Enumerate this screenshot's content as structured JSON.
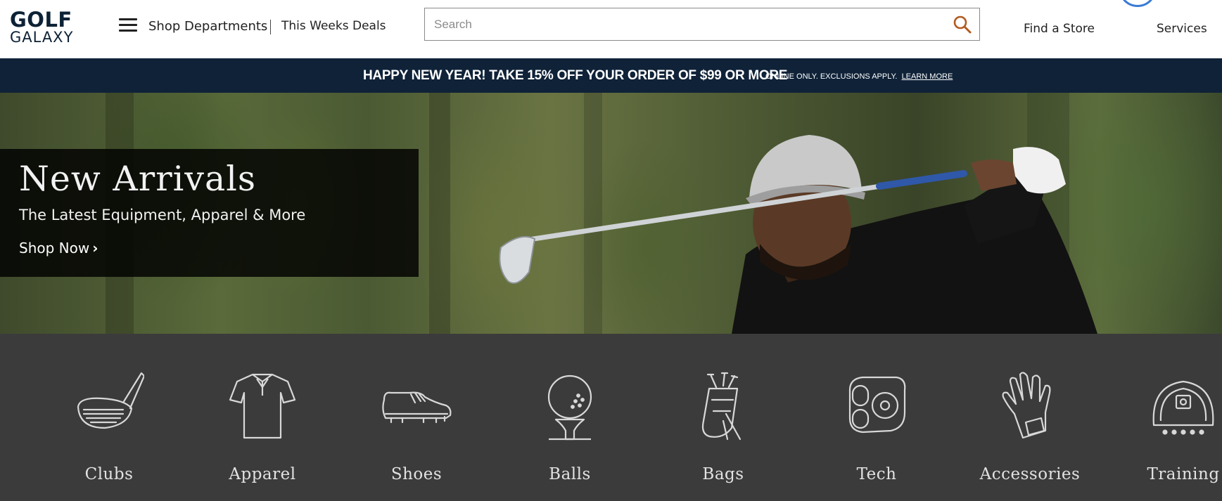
{
  "header": {
    "logo_top": "GOLF",
    "logo_bottom": "GALAXY",
    "shop_departments": "Shop Departments",
    "this_weeks_deals": "This Weeks Deals",
    "search_placeholder": "Search",
    "find_store": "Find a Store",
    "services": "Services"
  },
  "promo": {
    "headline": "HAPPY NEW YEAR! TAKE 15% OFF YOUR ORDER OF $99 OR MORE",
    "fine_print": "ONLINE ONLY. EXCLUSIONS APPLY.",
    "learn_more": "LEARN MORE"
  },
  "hero": {
    "title": "New Arrivals",
    "subtitle": "The Latest Equipment, Apparel & More",
    "cta": "Shop Now",
    "cta_chevron": "›"
  },
  "categories": [
    {
      "label": "Clubs",
      "icon": "golf-club-icon"
    },
    {
      "label": "Apparel",
      "icon": "polo-shirt-icon"
    },
    {
      "label": "Shoes",
      "icon": "golf-shoe-icon"
    },
    {
      "label": "Balls",
      "icon": "golf-ball-on-tee-icon"
    },
    {
      "label": "Bags",
      "icon": "golf-bag-icon"
    },
    {
      "label": "Tech",
      "icon": "rangefinder-icon"
    },
    {
      "label": "Accessories",
      "icon": "golf-glove-icon"
    },
    {
      "label": "Training",
      "icon": "launch-monitor-icon"
    }
  ],
  "colors": {
    "brand_navy": "#0f2238",
    "search_icon": "#b35a1f",
    "category_bg": "#3b3b3b"
  }
}
